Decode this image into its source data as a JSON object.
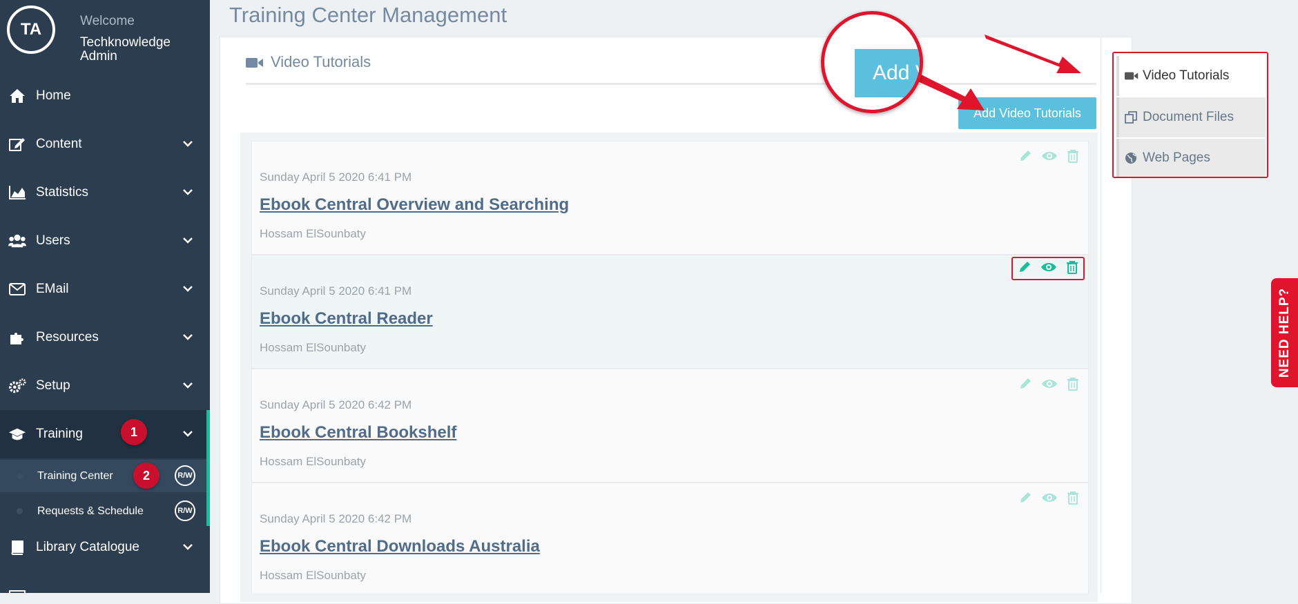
{
  "user": {
    "initials": "TA",
    "welcome": "Welcome",
    "name": "Techknowledge Admin"
  },
  "sidebar": {
    "items": [
      {
        "label": "Home"
      },
      {
        "label": "Content"
      },
      {
        "label": "Statistics"
      },
      {
        "label": "Users"
      },
      {
        "label": "EMail"
      },
      {
        "label": "Resources"
      },
      {
        "label": "Setup"
      },
      {
        "label": "Training"
      },
      {
        "label": "Library Catalogue"
      }
    ],
    "training_sub": [
      {
        "label": "Training Center",
        "badge": "R/W"
      },
      {
        "label": "Requests & Schedule",
        "badge": "R/W"
      }
    ],
    "step_badges": [
      "1",
      "2"
    ]
  },
  "page": {
    "title": "Training Center Management"
  },
  "section": {
    "title": "Video Tutorials",
    "add_button": "Add Video Tutorials",
    "zoom_text": "Add V"
  },
  "tutorials": [
    {
      "date": "Sunday April 5 2020 6:41 PM",
      "title": "Ebook Central Overview and Searching",
      "author": "Hossam ElSounbaty"
    },
    {
      "date": "Sunday April 5 2020 6:41 PM",
      "title": "Ebook Central Reader",
      "author": "Hossam ElSounbaty"
    },
    {
      "date": "Sunday April 5 2020 6:42 PM",
      "title": "Ebook Central Bookshelf",
      "author": "Hossam ElSounbaty"
    },
    {
      "date": "Sunday April 5 2020 6:42 PM",
      "title": "Ebook Central Downloads Australia",
      "author": "Hossam ElSounbaty"
    }
  ],
  "tabs": [
    {
      "label": "Video Tutorials"
    },
    {
      "label": "Document Files"
    },
    {
      "label": "Web Pages"
    }
  ],
  "help": {
    "label": "NEED HELP?"
  },
  "colors": {
    "sidebar": "#2b3d4f",
    "accent": "#1abc9c",
    "button": "#5bc0de",
    "callout": "#e0142c"
  }
}
